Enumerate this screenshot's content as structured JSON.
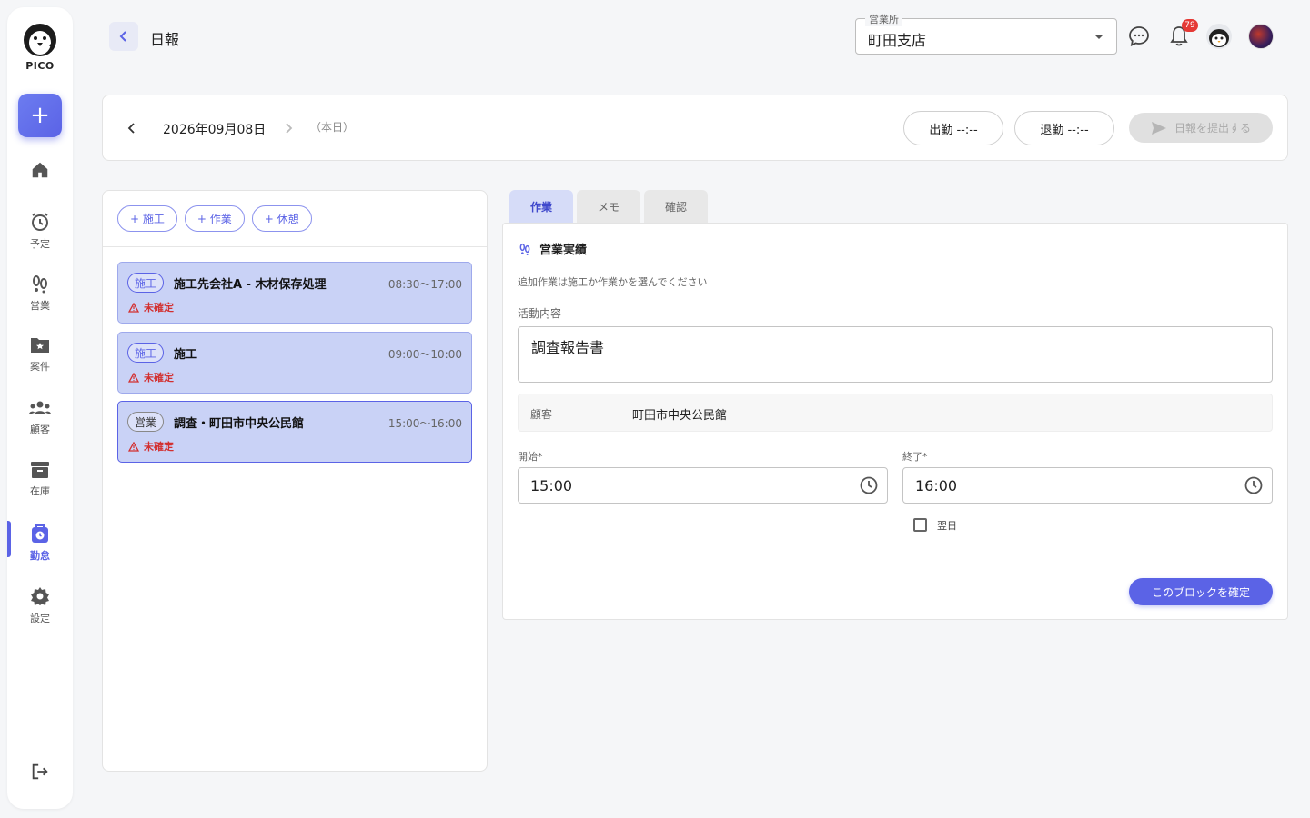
{
  "brand": {
    "name": "PICO"
  },
  "sidebar": {
    "add_label": "+",
    "items": [
      {
        "label": "",
        "icon": "home-icon"
      },
      {
        "label": "予定",
        "icon": "alarm-icon"
      },
      {
        "label": "営業",
        "icon": "footprints-icon"
      },
      {
        "label": "案件",
        "icon": "folder-star-icon"
      },
      {
        "label": "顧客",
        "icon": "people-icon"
      },
      {
        "label": "在庫",
        "icon": "archive-icon"
      },
      {
        "label": "勤怠",
        "icon": "clock-badge-icon",
        "active": true
      },
      {
        "label": "設定",
        "icon": "gear-icon"
      }
    ]
  },
  "header": {
    "title": "日報",
    "office_legend": "営業所",
    "office_value": "町田支店",
    "notification_count": "79"
  },
  "datebar": {
    "date": "2026年09月08日",
    "today_label": "（本日）",
    "clock_in": "出勤 --:--",
    "clock_out": "退勤 --:--",
    "submit": "日報を提出する"
  },
  "left": {
    "chips": [
      "+ 施工",
      "+ 作業",
      "+ 休憩"
    ],
    "cards": [
      {
        "tag": "施工",
        "title": "施工先会社A - 木材保存処理",
        "time": "08:30〜17:00",
        "status": "未確定"
      },
      {
        "tag": "施工",
        "title": "施工",
        "time": "09:00〜10:00",
        "status": "未確定"
      },
      {
        "tag": "営業",
        "title": "調査・町田市中央公民館",
        "time": "15:00〜16:00",
        "status": "未確定"
      }
    ]
  },
  "tabs": [
    "作業",
    "メモ",
    "確認"
  ],
  "detail": {
    "heading": "営業実績",
    "hint": "追加作業は施工か作業かを選んでください",
    "activity_label": "活動内容",
    "activity_value": "調査報告書",
    "customer_label": "顧客",
    "customer_value": "町田市中央公民館",
    "start_label": "開始*",
    "start_value": "15:00",
    "end_label": "終了*",
    "end_value": "16:00",
    "next_day_label": "翌日",
    "confirm_button": "このブロックを確定"
  },
  "colors": {
    "accent": "#5b63e6",
    "card_bg": "#c9d2f6",
    "danger": "#d32f2f"
  }
}
